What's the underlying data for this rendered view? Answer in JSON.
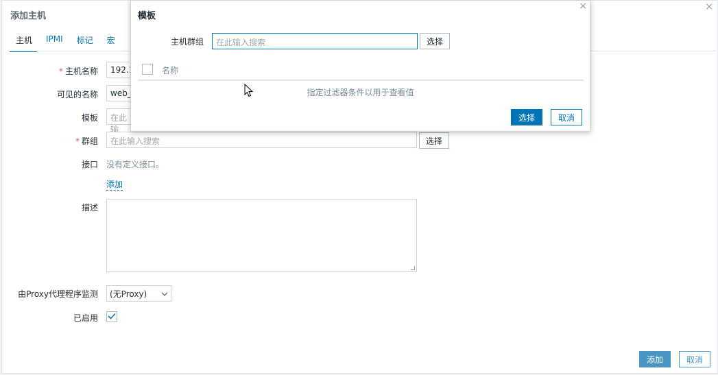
{
  "host_dialog": {
    "title": "添加主机",
    "close_glyph": "×",
    "tabs": [
      {
        "label": "主机",
        "active": true
      },
      {
        "label": "IPMI",
        "active": false
      },
      {
        "label": "标记",
        "active": false
      },
      {
        "label": "宏",
        "active": false
      }
    ],
    "fields": {
      "host_name_label": "主机名称",
      "host_name_value": "192.1",
      "visible_name_label": "可见的名称",
      "visible_name_value": "web_",
      "templates_label": "模板",
      "templates_placeholder": "在此输",
      "groups_label": "群组",
      "groups_placeholder": "在此输入搜索",
      "groups_select_button": "选择",
      "interfaces_label": "接口",
      "interfaces_empty": "没有定义接口。",
      "interfaces_add_link": "添加",
      "description_label": "描述",
      "proxy_label": "由Proxy代理程序监测",
      "proxy_value": "(无Proxy)",
      "enabled_label": "已启用",
      "enabled_checked": true
    },
    "footer": {
      "add_button": "添加",
      "cancel_button": "取消"
    }
  },
  "template_dialog": {
    "title": "模板",
    "close_glyph": "×",
    "host_group_label": "主机群组",
    "host_group_placeholder": "在此输入搜索",
    "select_button": "选择",
    "column_name": "名称",
    "empty_message": "指定过滤器条件以用于查看值",
    "footer": {
      "select_button": "选择",
      "cancel_button": "取消"
    }
  },
  "colors": {
    "accent": "#0275b8",
    "required": "#e45959"
  }
}
